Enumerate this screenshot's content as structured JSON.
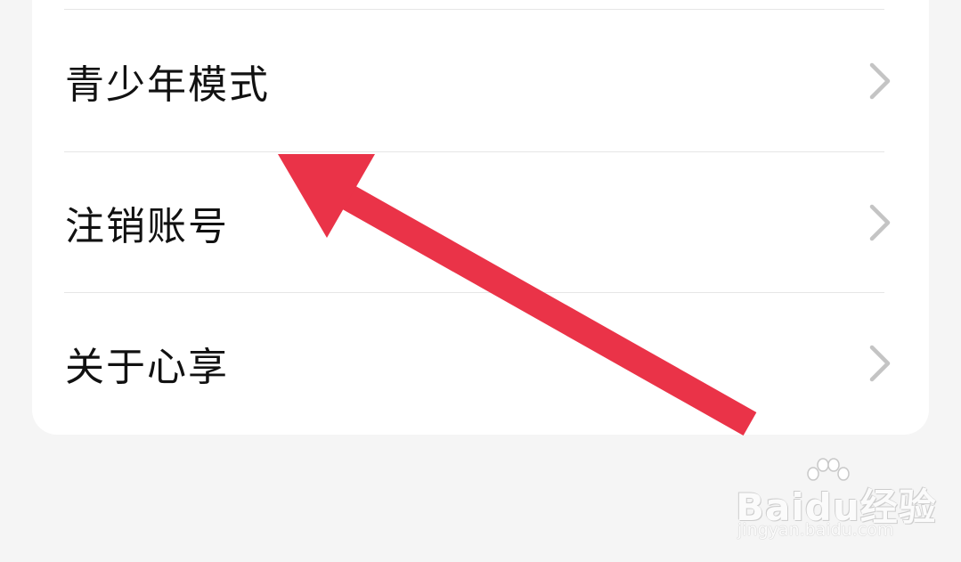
{
  "settings": {
    "items": [
      {
        "label": "青少年模式"
      },
      {
        "label": "注销账号"
      },
      {
        "label": "关于心享"
      }
    ]
  },
  "annotation": {
    "arrow_color": "#ea3348"
  },
  "watermark": {
    "logo_text": "Baidu经验",
    "url": "jingyan.baidu.com"
  },
  "colors": {
    "background": "#f5f5f5",
    "card": "#ffffff",
    "divider": "#e6e6e6",
    "chevron": "#c4c4c4",
    "text": "#111111"
  }
}
